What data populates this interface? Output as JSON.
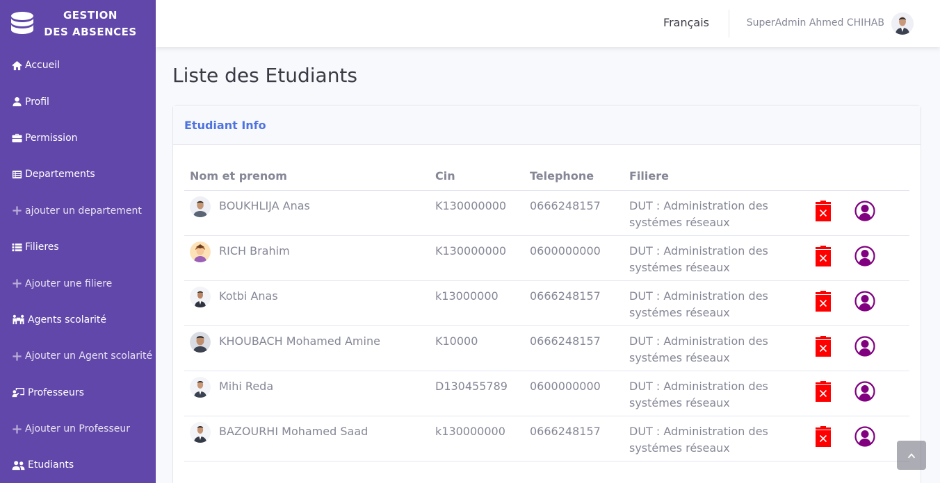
{
  "brand": {
    "line1": "GESTION",
    "line2": "DES ABSENCES"
  },
  "sidebar": {
    "items": [
      {
        "label": "Accueil",
        "icon": "home-icon"
      },
      {
        "label": "Profil",
        "icon": "user-icon"
      },
      {
        "label": "Permission",
        "icon": "briefcase-icon"
      },
      {
        "label": "Departements",
        "icon": "list-alt-icon"
      },
      {
        "label": "ajouter un departement",
        "icon": "plus-icon"
      },
      {
        "label": "Filieres",
        "icon": "list-icon"
      },
      {
        "label": "Ajouter une filiere",
        "icon": "plus-icon"
      },
      {
        "label": "Agents scolarité",
        "icon": "people-carry-icon"
      },
      {
        "label": "Ajouter un Agent scolarité",
        "icon": "plus-icon"
      },
      {
        "label": "Professeurs",
        "icon": "chalkboard-teacher-icon"
      },
      {
        "label": "Ajouter un Professeur",
        "icon": "plus-icon"
      },
      {
        "label": "Etudiants",
        "icon": "user-friends-icon"
      }
    ]
  },
  "topbar": {
    "language": "Français",
    "user_name": "SuperAdmin Ahmed CHIHAB"
  },
  "page": {
    "title": "Liste des Etudiants"
  },
  "card": {
    "title": "Etudiant Info"
  },
  "table": {
    "headers": [
      "Nom et prenom",
      "Cin",
      "Telephone",
      "Filiere"
    ],
    "rows": [
      {
        "name": "BOUKHLIJA Anas",
        "cin": "K130000000",
        "phone": "0666248157",
        "filiere": "DUT : Administration des systémes réseaux"
      },
      {
        "name": "RICH Brahim",
        "cin": "K130000000",
        "phone": "0600000000",
        "filiere": "DUT : Administration des systémes réseaux"
      },
      {
        "name": "Kotbi Anas",
        "cin": "k13000000",
        "phone": "0666248157",
        "filiere": "DUT : Administration des systémes réseaux"
      },
      {
        "name": "KHOUBACH Mohamed Amine",
        "cin": "K10000",
        "phone": "0666248157",
        "filiere": "DUT : Administration des systémes réseaux"
      },
      {
        "name": "Mihi Reda",
        "cin": "D130455789",
        "phone": "0600000000",
        "filiere": "DUT : Administration des systémes réseaux"
      },
      {
        "name": "BAZOURHI Mohamed Saad",
        "cin": "k130000000",
        "phone": "0666248157",
        "filiere": "DUT : Administration des systémes réseaux"
      }
    ]
  },
  "colors": {
    "sidebar": "#6247aa",
    "delete": "#ff0000",
    "profile": "#800080",
    "accent": "#4e73df"
  }
}
